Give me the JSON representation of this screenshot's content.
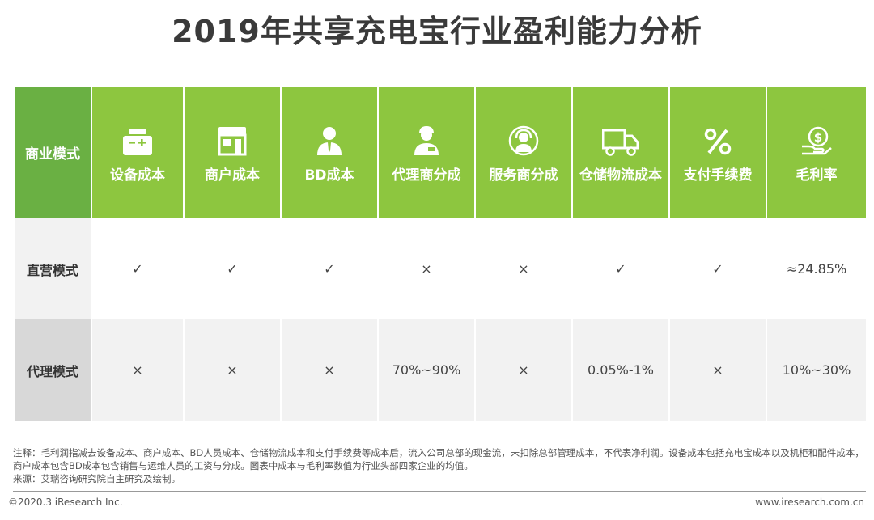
{
  "title": "2019年共享充电宝行业盈利能力分析",
  "table": {
    "corner_label": "商业模式",
    "columns": [
      {
        "label": "设备成本",
        "icon": "charging-device-icon"
      },
      {
        "label": "商户成本",
        "icon": "storefront-icon"
      },
      {
        "label": "BD成本",
        "icon": "business-person-icon"
      },
      {
        "label": "代理商分成",
        "icon": "agent-person-icon"
      },
      {
        "label": "服务商分成",
        "icon": "service-headset-icon"
      },
      {
        "label": "仓储物流成本",
        "icon": "delivery-truck-icon"
      },
      {
        "label": "支付手续费",
        "icon": "percent-icon"
      },
      {
        "label": "毛利率",
        "icon": "money-hand-icon"
      }
    ],
    "rows": [
      {
        "label": "直营模式",
        "cells": [
          "✓",
          "✓",
          "✓",
          "×",
          "×",
          "✓",
          "✓",
          "≈24.85%"
        ]
      },
      {
        "label": "代理模式",
        "cells": [
          "×",
          "×",
          "×",
          "70%~90%",
          "×",
          "0.05%-1%",
          "×",
          "10%~30%"
        ]
      }
    ]
  },
  "notes": {
    "line1": "注释：毛利润指减去设备成本、商户成本、BD人员成本、仓储物流成本和支付手续费等成本后，流入公司总部的现金流，未扣除总部管理成本，不代表净利润。设备成本包括充电宝成本以及机柜和配件成本，商户成本包含BD成本包含销售与运维人员的工资与分成。图表中成本与毛利率数值为行业头部四家企业的均值。",
    "line2": "来源：艾瑞咨询研究院自主研究及绘制。"
  },
  "footer": {
    "left": "©2020.3 iResearch Inc.",
    "right": "www.iresearch.com.cn"
  },
  "colors": {
    "header_green": "#8dc63f",
    "corner_green": "#6ab043",
    "row_header_gray": "#d8d8d8"
  }
}
